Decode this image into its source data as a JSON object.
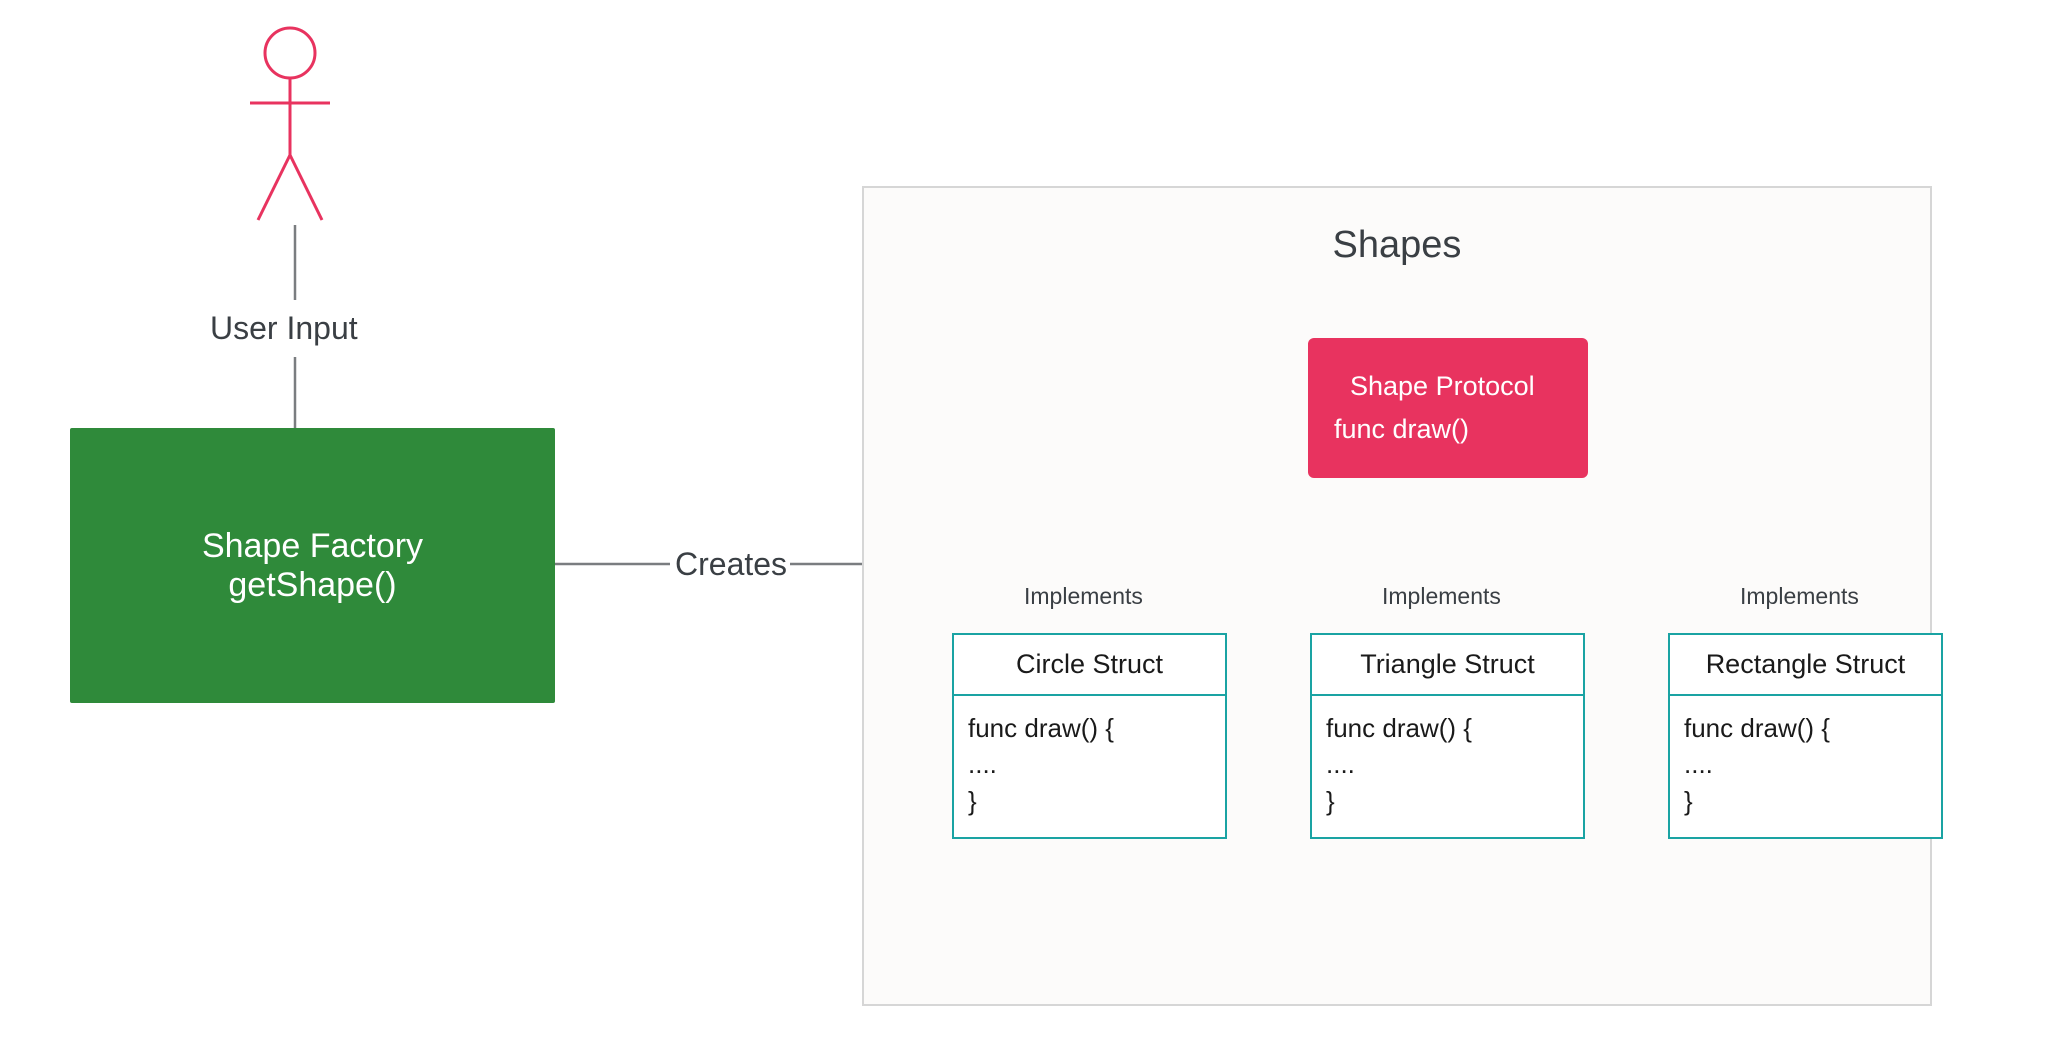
{
  "user_input_label": "User Input",
  "factory": {
    "title": "Shape Factory",
    "method": "getShape()"
  },
  "creates_label": "Creates",
  "shapes_container_title": "Shapes",
  "protocol": {
    "title": "Shape Protocol",
    "method": "func draw()"
  },
  "implements_label": "Implements",
  "structs": [
    {
      "name": "Circle Struct",
      "body": "func draw() {\n....\n}"
    },
    {
      "name": "Triangle Struct",
      "body": "func draw() {\n....\n}"
    },
    {
      "name": "Rectangle Struct",
      "body": "func draw() {\n....\n}"
    }
  ]
}
